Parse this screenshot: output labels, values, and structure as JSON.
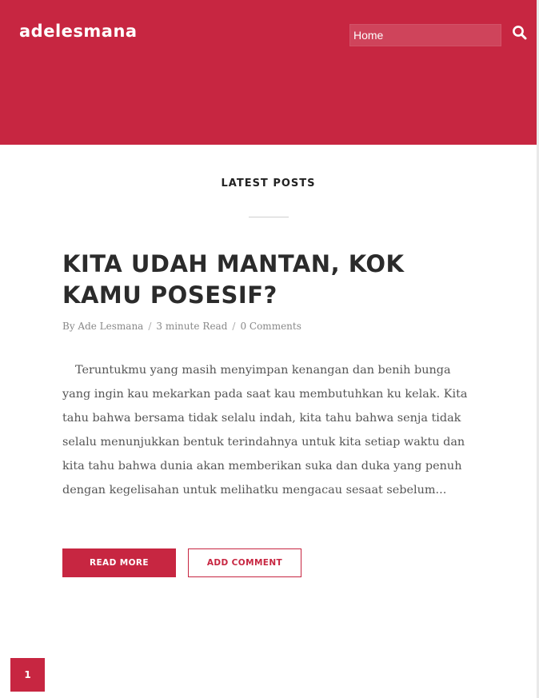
{
  "site": {
    "logo": "adelesmana",
    "accent_color": "#c72641"
  },
  "header": {
    "nav_selected": "Home",
    "search_icon": "search-icon"
  },
  "section": {
    "title": "LATEST POSTS"
  },
  "post": {
    "title": "KITA UDAH MANTAN, KOK KAMU POSESIF?",
    "meta": {
      "author": "By Ade Lesmana",
      "read_time_a": "3 minute",
      "read_time_b": "Read",
      "comments": "0 Comments"
    },
    "excerpt": "Teruntukmu yang masih menyimpan kenangan dan benih bunga yang ingin kau mekarkan pada saat kau membutuhkan ku kelak. Kita tahu bahwa bersama tidak selalu indah, kita tahu bahwa senja tidak selalu menunjukkan bentuk terindahnya untuk kita setiap waktu dan kita tahu bahwa dunia akan memberikan suka dan duka yang penuh dengan kegelisahan untuk melihatku mengacau sesaat sebelum...",
    "read_more_label": "READ MORE",
    "add_comment_label": "ADD COMMENT"
  },
  "pagination": {
    "current": "1"
  }
}
